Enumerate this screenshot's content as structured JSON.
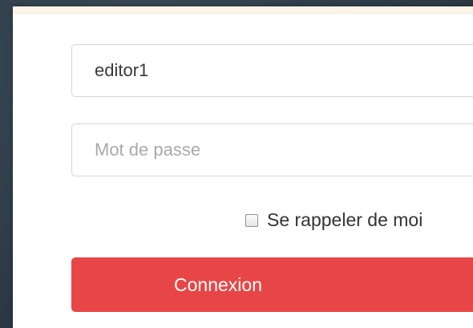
{
  "login_form": {
    "username_value": "editor1",
    "password_placeholder": "Mot de passe",
    "remember_label": "Se rappeler de moi",
    "submit_label": "Connexion"
  },
  "colors": {
    "submit_button": "#e84646",
    "background": "#2f3d49",
    "panel": "#ffffff"
  }
}
